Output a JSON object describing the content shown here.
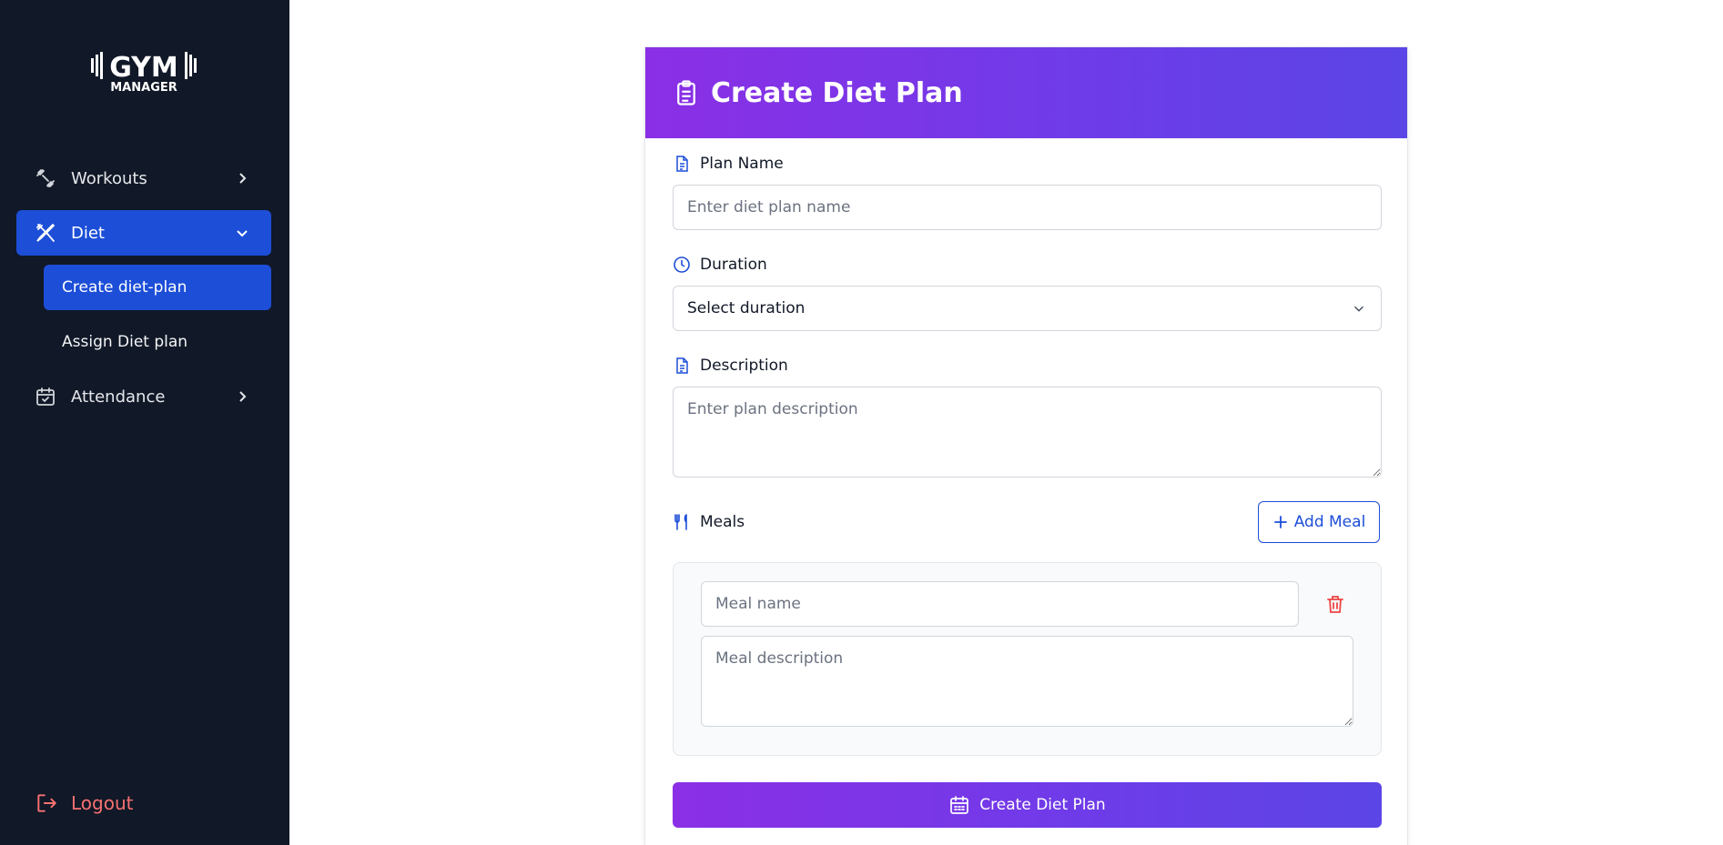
{
  "sidebar": {
    "logo": {
      "top": "GYM",
      "bottom": "MANAGER"
    },
    "items": [
      {
        "label": "Workouts",
        "icon": "dumbbell-icon"
      },
      {
        "label": "Diet",
        "icon": "utensils-icon"
      },
      {
        "label": "Attendance",
        "icon": "calendar-check-icon"
      }
    ],
    "sub_items": [
      {
        "label": "Create diet-plan"
      },
      {
        "label": "Assign Diet plan"
      }
    ],
    "logout_label": "Logout"
  },
  "form": {
    "title": "Create Diet Plan",
    "plan_name": {
      "label": "Plan Name",
      "placeholder": "Enter diet plan name"
    },
    "duration": {
      "label": "Duration",
      "value": "Select duration"
    },
    "description": {
      "label": "Description",
      "placeholder": "Enter plan description"
    },
    "meals": {
      "label": "Meals",
      "add_label": "Add Meal",
      "meal_name_placeholder": "Meal name",
      "meal_description_placeholder": "Meal description"
    },
    "submit_label": "Create Diet Plan"
  },
  "colors": {
    "sidebar_bg": "#111827",
    "active_blue": "#1d4ed8",
    "header_gradient_start": "#8b2fe6",
    "header_gradient_end": "#5b45e6",
    "logout_red": "#f87171"
  }
}
